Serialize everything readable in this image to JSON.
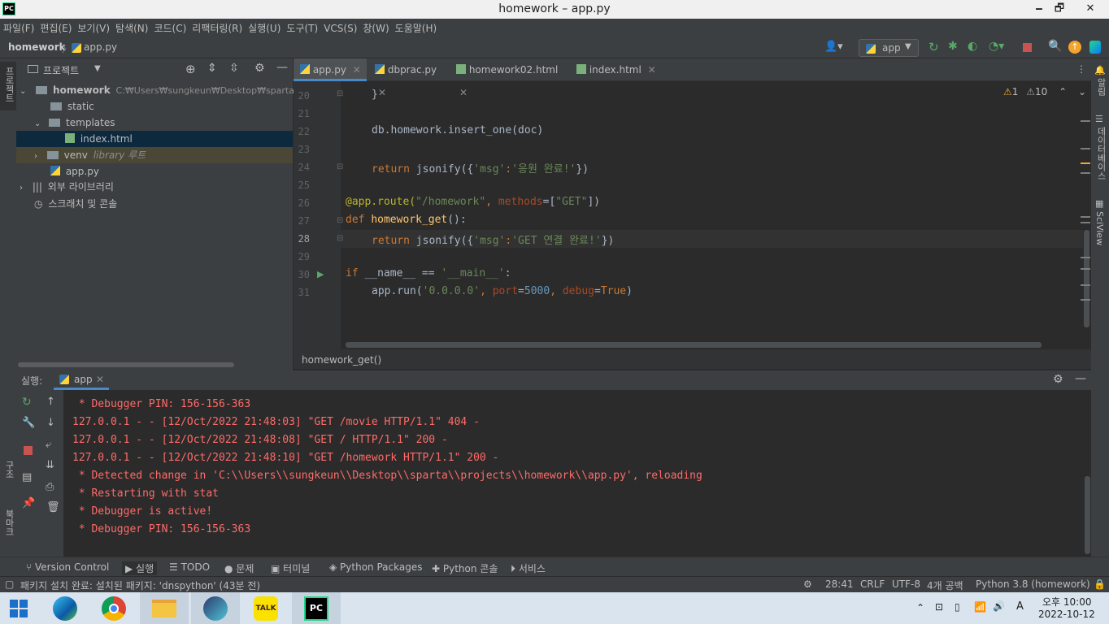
{
  "window": {
    "title": "homework – app.py",
    "minimize": "🗕",
    "maximize": "🗗",
    "close": "✕"
  },
  "menu": [
    "파일(F)",
    "편집(E)",
    "보기(V)",
    "탐색(N)",
    "코드(C)",
    "리팩터링(R)",
    "실행(U)",
    "도구(T)",
    "VCS(S)",
    "창(W)",
    "도움말(H)"
  ],
  "nav": {
    "project": "homework",
    "sep": "〉",
    "file": "app.py",
    "run_config": "app"
  },
  "left_strip": {
    "project": "프로젝트",
    "structure": "구조",
    "bookmarks": "북마크"
  },
  "right_strip": {
    "notifications": "알림",
    "database": "데이터베이스",
    "sciview": "SciView"
  },
  "project_panel": {
    "title": "프로젝트",
    "root_name": "homework",
    "root_path": "C:₩Users₩sungkeun₩Desktop₩sparta₩proj",
    "static": "static",
    "templates": "templates",
    "index": "index.html",
    "venv": "venv",
    "venv_note": "library 루트",
    "app": "app.py",
    "ext_libs": "외부 라이브러리",
    "scratch": "스크래치 및 콘솔"
  },
  "tabs": [
    "app.py",
    "dbprac.py",
    "homework02.html",
    "index.html"
  ],
  "inspection": {
    "warnings": "1",
    "weak_warnings": "10"
  },
  "line_numbers": [
    "20",
    "21",
    "22",
    "23",
    "24",
    "25",
    "26",
    "27",
    "28",
    "29",
    "30",
    "31"
  ],
  "code": {
    "l20": "}",
    "l22": "db.homework.insert_one(doc)",
    "l24_a": "return ",
    "l24_b": "jsonify({",
    "l24_c": "'msg'",
    "l24_d": ":",
    "l24_e": "'응원 완료!'",
    "l24_f": "})",
    "l26_a": "@app.route(",
    "l26_b": "\"/homework\"",
    "l26_c": ", ",
    "l26_d": "methods",
    "l26_e": "=[",
    "l26_f": "\"GET\"",
    "l26_g": "])",
    "l27_a": "def ",
    "l27_b": "homework_get",
    "l27_c": "():",
    "l28_a": "return ",
    "l28_b": "jsonify({",
    "l28_c": "'msg'",
    "l28_d": ":",
    "l28_e": "'GET 연결 완료!'",
    "l28_f": "})",
    "l30_a": "if ",
    "l30_b": "__name__ == ",
    "l30_c": "'__main__'",
    "l30_d": ":",
    "l31_a": "app.run(",
    "l31_b": "'0.0.0.0'",
    "l31_c": ", ",
    "l31_d": "port",
    "l31_e": "=",
    "l31_f": "5000",
    "l31_g": ", ",
    "l31_h": "debug",
    "l31_i": "=",
    "l31_j": "True",
    "l31_k": ")"
  },
  "breadcrumb": "homework_get()",
  "run_panel": {
    "label": "실행:",
    "tab": "app"
  },
  "console": [
    {
      "text": " * Debugger PIN: 156-156-363",
      "color": "#ff6b68"
    },
    {
      "text": "127.0.0.1 - - [12/Oct/2022 21:48:03] \"GET /movie HTTP/1.1\" 404 -",
      "color": "#ff6b68"
    },
    {
      "text": "127.0.0.1 - - [12/Oct/2022 21:48:08] \"GET / HTTP/1.1\" 200 -",
      "color": "#ff6b68"
    },
    {
      "text": "127.0.0.1 - - [12/Oct/2022 21:48:10] \"GET /homework HTTP/1.1\" 200 -",
      "color": "#ff6b68"
    },
    {
      "text": " * Detected change in 'C:\\\\Users\\\\sungkeun\\\\Desktop\\\\sparta\\\\projects\\\\homework\\\\app.py', reloading",
      "color": "#ff6b68"
    },
    {
      "text": " * Restarting with stat",
      "color": "#ff6b68"
    },
    {
      "text": " * Debugger is active!",
      "color": "#ff6b68"
    },
    {
      "text": " * Debugger PIN: 156-156-363",
      "color": "#ff6b68"
    }
  ],
  "bottom_tabs": [
    "Version Control",
    "실행",
    "TODO",
    "문제",
    "터미널",
    "Python Packages",
    "Python 콘솔",
    "서비스"
  ],
  "status": {
    "message": "패키지 설치 완료: 설치된 패키지: 'dnspython' (43분 전)",
    "position": "28:41",
    "line_sep": "CRLF",
    "encoding": "UTF-8",
    "indent": "4개 공백",
    "interpreter": "Python 3.8 (homework)"
  },
  "taskbar": {
    "kakao": "TALK",
    "pycharm": "PC",
    "ampm": "오후 10:00",
    "date": "2022-10-12"
  }
}
